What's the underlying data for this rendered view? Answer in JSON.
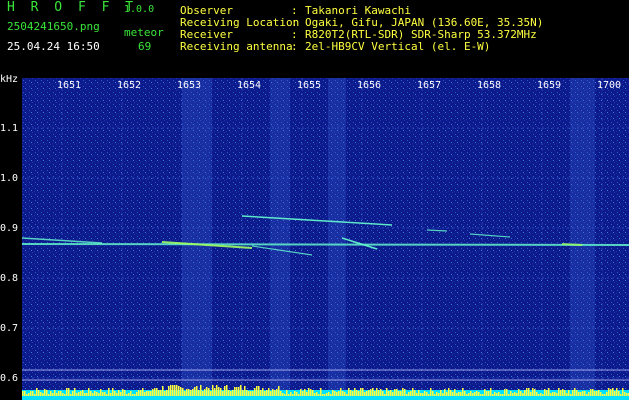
{
  "header": {
    "app_title": "H R O F F T",
    "version": "1.0.0",
    "filename": "2504241650.png",
    "timestamp": "25.04.24 16:50",
    "mode_label": "meteor",
    "count": "69",
    "info": [
      {
        "label": "Observer",
        "value": "Takanori Kawachi"
      },
      {
        "label": "Receiving Location",
        "value": "Ogaki, Gifu, JAPAN (136.60E, 35.35N)"
      },
      {
        "label": "Receiver",
        "value": "R820T2(RTL-SDR) SDR-Sharp 53.372MHz"
      },
      {
        "label": "Receiving antenna",
        "value": "2el-HB9CV Vertical (el. E-W)"
      }
    ]
  },
  "chart_data": {
    "type": "heatmap",
    "ylabel": "kHz",
    "y_ticks": [
      "1.1",
      "1.0",
      "0.9",
      "0.8",
      "0.7",
      "0.6"
    ],
    "x_ticks": [
      "1651",
      "1652",
      "1653",
      "1654",
      "1655",
      "1656",
      "1657",
      "1658",
      "1659",
      "1700"
    ],
    "ylim": [
      0.58,
      1.18
    ],
    "colors": {
      "background": "#0d1a8c",
      "trace": "#66ffd0",
      "level": "#ffff40",
      "floor": "#00e0ff"
    }
  }
}
